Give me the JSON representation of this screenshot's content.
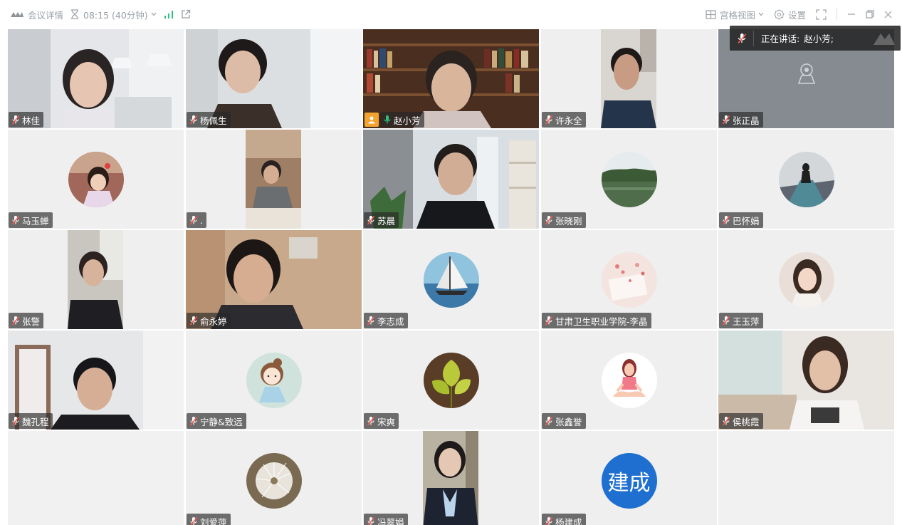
{
  "topbar": {
    "meeting_details": "会议详情",
    "timer": "08:15 (40分钟)",
    "layout": "宫格视图",
    "settings": "设置"
  },
  "speaking_now": {
    "label": "正在讲话:",
    "name": "赵小芳;"
  },
  "colors": {
    "speaking_border": "#21c27f",
    "host_badge": "#f3a430",
    "text_avatar": "#1e6fd0"
  },
  "participants": [
    {
      "name": "林佳",
      "view": "video"
    },
    {
      "name": "杨佩生",
      "view": "video"
    },
    {
      "name": "赵小芳",
      "view": "video",
      "speaking": true,
      "host": true
    },
    {
      "name": "许永全",
      "view": "video"
    },
    {
      "name": "张正晶",
      "view": "camera-off"
    },
    {
      "name": "马玉蝉",
      "view": "avatar"
    },
    {
      "name": ".",
      "view": "video"
    },
    {
      "name": "苏晨",
      "view": "video"
    },
    {
      "name": "张晓刚",
      "view": "avatar"
    },
    {
      "name": "巴怀娟",
      "view": "avatar"
    },
    {
      "name": "张警",
      "view": "video"
    },
    {
      "name": "俞永婷",
      "view": "video"
    },
    {
      "name": "李志成",
      "view": "avatar"
    },
    {
      "name": "甘肃卫生职业学院-李晶",
      "view": "avatar"
    },
    {
      "name": "王玉萍",
      "view": "avatar"
    },
    {
      "name": "魏孔程",
      "view": "video"
    },
    {
      "name": "宁静&致远",
      "view": "avatar"
    },
    {
      "name": "宋爽",
      "view": "avatar"
    },
    {
      "name": "张鑫誉",
      "view": "avatar"
    },
    {
      "name": "侯桃霞",
      "view": "video"
    },
    {
      "name": "刘爱萍",
      "view": "avatar"
    },
    {
      "name": "冯翠娟",
      "view": "video"
    },
    {
      "name": "杨建成",
      "view": "text-avatar",
      "avatar_text": "建成"
    }
  ]
}
